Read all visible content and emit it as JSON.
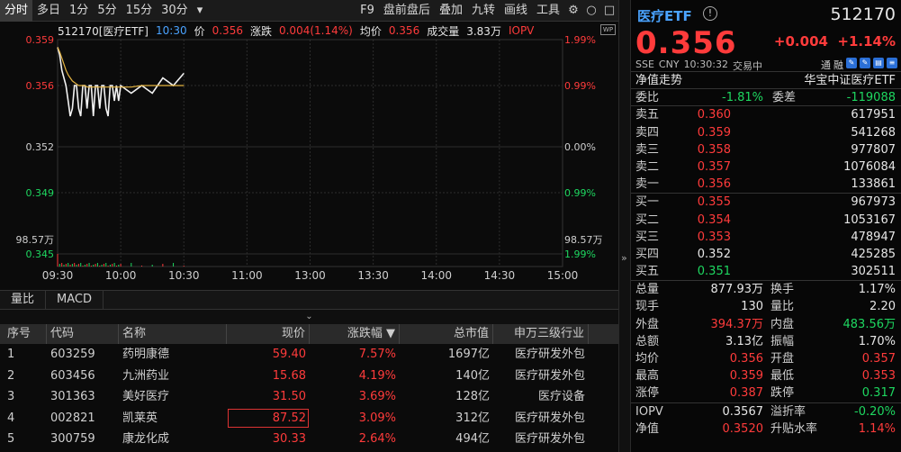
{
  "toolbar": {
    "tabs": [
      "分时",
      "多日",
      "1分",
      "5分",
      "15分",
      "30分"
    ],
    "dropdown": "▾",
    "right": [
      "F9",
      "盘前盘后",
      "叠加",
      "九转",
      "画线",
      "工具"
    ]
  },
  "chart": {
    "code_name": "512170[医疗ETF]",
    "time": "10:30",
    "price_label": "价",
    "price": "0.356",
    "chg_label": "涨跌",
    "chg": "0.004(1.14%)",
    "avg_label": "均价",
    "avg": "0.356",
    "vol_label": "成交量",
    "vol": "3.83万",
    "iopv": "IOPV",
    "wp": "WP",
    "y_left": [
      "0.359",
      "0.356",
      "0.352",
      "0.349",
      "0.345"
    ],
    "y_right": [
      "1.99%",
      "0.99%",
      "0.00%",
      "0.99%",
      "1.99%"
    ],
    "vol_axis": "98.57万",
    "x_labels": [
      "09:30",
      "10:00",
      "10:30",
      "11:00",
      "13:00",
      "13:30",
      "14:00",
      "14:30",
      "15:00"
    ]
  },
  "chart_data": {
    "type": "line",
    "title": "",
    "xlabel": "",
    "ylabel": "",
    "ylim": [
      0.345,
      0.359
    ],
    "x": [
      "09:30",
      "09:31",
      "09:32",
      "09:33",
      "09:34",
      "09:35",
      "09:36",
      "09:37",
      "09:38",
      "09:39",
      "09:40",
      "09:41",
      "09:42",
      "09:43",
      "09:44",
      "09:45",
      "09:46",
      "09:47",
      "09:48",
      "09:49",
      "09:50",
      "09:51",
      "09:52",
      "09:53",
      "09:54",
      "09:55",
      "09:56",
      "09:57",
      "09:58",
      "09:59",
      "10:00",
      "10:05",
      "10:10",
      "10:15",
      "10:20",
      "10:25",
      "10:30"
    ],
    "series": [
      {
        "name": "价",
        "values": [
          0.3585,
          0.358,
          0.357,
          0.3565,
          0.356,
          0.355,
          0.354,
          0.3545,
          0.356,
          0.356,
          0.3545,
          0.354,
          0.356,
          0.356,
          0.3545,
          0.356,
          0.356,
          0.354,
          0.356,
          0.356,
          0.3545,
          0.356,
          0.356,
          0.3545,
          0.354,
          0.356,
          0.356,
          0.355,
          0.356,
          0.355,
          0.356,
          0.3555,
          0.356,
          0.3555,
          0.3565,
          0.356,
          0.3568
        ]
      },
      {
        "name": "均价",
        "values": [
          0.3585,
          0.3582,
          0.3578,
          0.3574,
          0.357,
          0.3567,
          0.3565,
          0.3563,
          0.3562,
          0.3561,
          0.356,
          0.356,
          0.356,
          0.356,
          0.3559,
          0.3559,
          0.3559,
          0.3559,
          0.3559,
          0.3559,
          0.3559,
          0.3559,
          0.3559,
          0.3559,
          0.3559,
          0.3559,
          0.3559,
          0.3559,
          0.3559,
          0.3559,
          0.3559,
          0.3559,
          0.356,
          0.356,
          0.356,
          0.356,
          0.356
        ]
      }
    ]
  },
  "subtabs": [
    "量比",
    "MACD"
  ],
  "collapse": "⌄",
  "table": {
    "headers": [
      "序号",
      "代码",
      "名称",
      "现价",
      "涨跌幅 ▼",
      "总市值",
      "申万三级行业"
    ],
    "rows": [
      [
        "1",
        "603259",
        "药明康德",
        "59.40",
        "7.57%",
        "1697亿",
        "医疗研发外包"
      ],
      [
        "2",
        "603456",
        "九洲药业",
        "15.68",
        "4.19%",
        "140亿",
        "医疗研发外包"
      ],
      [
        "3",
        "301363",
        "美好医疗",
        "31.50",
        "3.69%",
        "128亿",
        "医疗设备"
      ],
      [
        "4",
        "002821",
        "凯莱英",
        "87.52",
        "3.09%",
        "312亿",
        "医疗研发外包"
      ],
      [
        "5",
        "300759",
        "康龙化成",
        "30.33",
        "2.64%",
        "494亿",
        "医疗研发外包"
      ]
    ]
  },
  "splitter": "»",
  "quote": {
    "name": "医疗ETF",
    "info": "!",
    "code": "512170",
    "price": "0.356",
    "change": "+0.004",
    "pct": "+1.14%",
    "meta": [
      "SSE",
      "CNY",
      "10:30:32",
      "交易中"
    ],
    "flags": [
      "通",
      "融"
    ],
    "nav_label": "净值走势",
    "index_name": "华宝中证医疗ETF",
    "wb_label": "委比",
    "wb": "-1.81%",
    "wc_label": "委差",
    "wc": "-119088",
    "asks": [
      [
        "卖五",
        "0.360",
        "617951"
      ],
      [
        "卖四",
        "0.359",
        "541268"
      ],
      [
        "卖三",
        "0.358",
        "977807"
      ],
      [
        "卖二",
        "0.357",
        "1076084"
      ],
      [
        "卖一",
        "0.356",
        "133861"
      ]
    ],
    "bids": [
      [
        "买一",
        "0.355",
        "967973"
      ],
      [
        "买二",
        "0.354",
        "1053167"
      ],
      [
        "买三",
        "0.353",
        "478947"
      ],
      [
        "买四",
        "0.352",
        "425285"
      ],
      [
        "买五",
        "0.351",
        "302511"
      ]
    ],
    "stats": [
      [
        "总量",
        "877.93万",
        "换手",
        "1.17%"
      ],
      [
        "现手",
        "130",
        "量比",
        "2.20"
      ],
      [
        "外盘",
        "394.37万",
        "内盘",
        "483.56万"
      ],
      [
        "总额",
        "3.13亿",
        "振幅",
        "1.70%"
      ],
      [
        "均价",
        "0.356",
        "开盘",
        "0.357"
      ],
      [
        "最高",
        "0.359",
        "最低",
        "0.353"
      ],
      [
        "涨停",
        "0.387",
        "跌停",
        "0.317"
      ]
    ],
    "iopv": [
      [
        "IOPV",
        "0.3567",
        "溢折率",
        "-0.20%"
      ],
      [
        "净值",
        "0.3520",
        "升贴水率",
        "1.14%"
      ]
    ]
  },
  "colors": {
    "up": "#ff3b3b",
    "down": "#1ed760",
    "accent": "#4aa3ff"
  }
}
